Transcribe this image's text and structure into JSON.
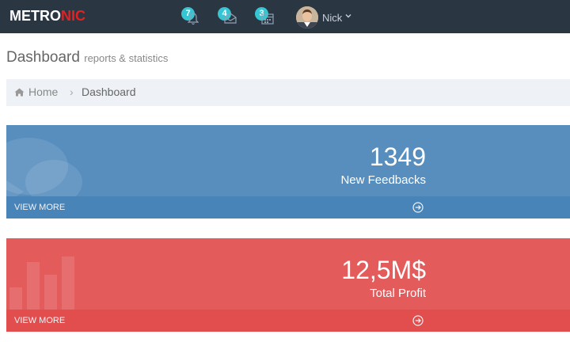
{
  "header": {
    "logo_main": "METRO",
    "logo_accent": "NIC",
    "notifications": [
      {
        "badge": "7",
        "icon": "bell-icon"
      },
      {
        "badge": "4",
        "icon": "envelope-icon"
      },
      {
        "badge": "3",
        "icon": "calendar-icon"
      }
    ],
    "user": {
      "name": "Nick"
    }
  },
  "page": {
    "title": "Dashboard",
    "subtitle": "reports & statistics"
  },
  "breadcrumb": {
    "home": "Home",
    "separator": "›",
    "current": "Dashboard"
  },
  "stats": [
    {
      "number": "1349",
      "description": "New Feedbacks",
      "more": "VIEW MORE",
      "color": "#578ebe",
      "icon": "comments-icon"
    },
    {
      "number": "12,5M$",
      "description": "Total Profit",
      "more": "VIEW MORE",
      "color": "#e35b5a",
      "icon": "bar-chart-icon"
    }
  ],
  "colors": {
    "header_bg": "#2b3643",
    "logo_accent": "#e02222",
    "badge": "#36c6d3",
    "breadcrumb_bg": "#eef1f5"
  }
}
